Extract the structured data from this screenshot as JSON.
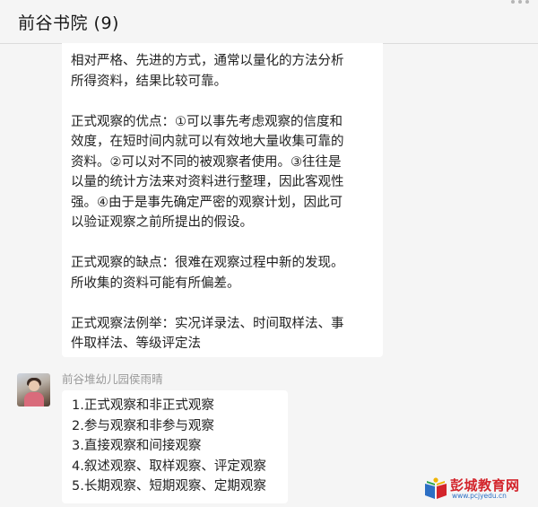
{
  "header": {
    "title": "前谷书院 (9)"
  },
  "messages": [
    {
      "lines": [
        "相对严格、先进的方式，通常以量化的方法分析",
        "所得资料，结果比较可靠。",
        "",
        "正式观察的优点：①可以事先考虑观察的信度和",
        "效度，在短时间内就可以有效地大量收集可靠的",
        "资料。②可以对不同的被观察者使用。③往往是",
        "以量的统计方法来对资料进行整理，因此客观性",
        "强。④由于是事先确定严密的观察计划，因此可",
        "以验证观察之前所提出的假设。",
        "",
        "正式观察的缺点：很难在观察过程中新的发现。",
        "所收集的资料可能有所偏差。",
        "",
        "正式观察法例举：实况详录法、时间取样法、事",
        "件取样法、等级评定法"
      ]
    },
    {
      "sender": "前谷堆幼儿园侯雨晴",
      "lines": [
        "1.正式观察和非正式观察",
        "2.参与观察和非参与观察",
        "3.直接观察和间接观察",
        "4.叙述观察、取样观察、评定观察",
        "5.长期观察、短期观察、定期观察"
      ]
    }
  ],
  "watermark": {
    "name": "彭城教育网",
    "url": "www.pcjyedu.cn"
  },
  "colors": {
    "background": "#f5f5f5",
    "bubble": "#ffffff",
    "watermark_red": "#d3242b",
    "watermark_blue": "#2c6fc4"
  }
}
